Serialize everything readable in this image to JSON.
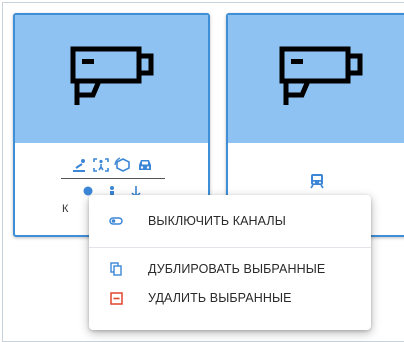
{
  "cards": [
    {
      "label": "К"
    },
    {
      "label": ""
    }
  ],
  "context_menu": {
    "items": [
      {
        "label": "ВЫКЛЮЧИТЬ КАНАЛЫ",
        "icon": "toggle-off-icon"
      },
      {
        "label": "ДУБЛИРОВАТЬ ВЫБРАННЫЕ",
        "icon": "copy-icon"
      },
      {
        "label": "УДАЛИТЬ ВЫБРАННЫЕ",
        "icon": "remove-box-icon"
      }
    ]
  },
  "colors": {
    "card_border": "#3f8fd8",
    "thumbnail_bg": "#8ec2f2",
    "analytics_icon": "#3b86d6",
    "delete_icon": "#e0452e"
  }
}
